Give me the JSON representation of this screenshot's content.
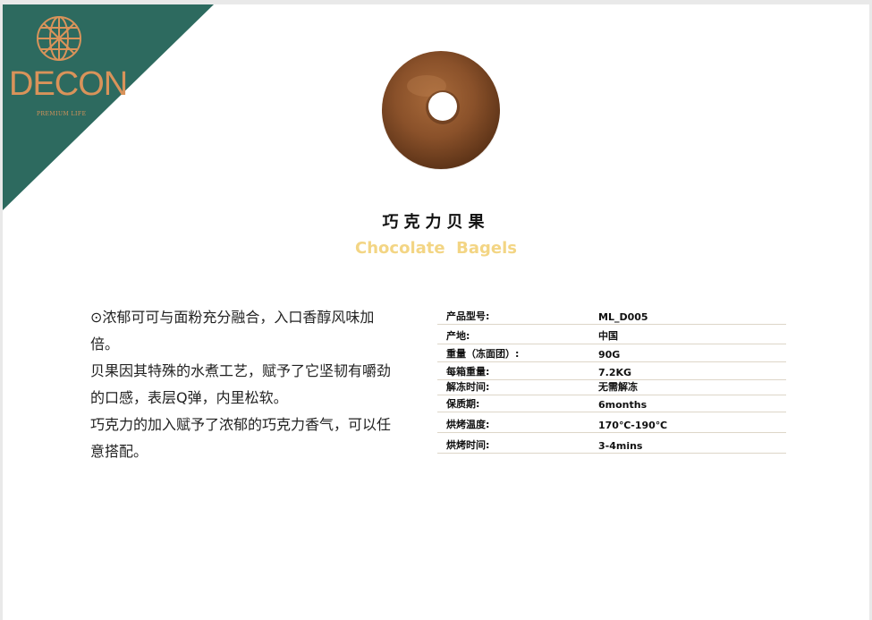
{
  "brand": {
    "name": "DECON",
    "tagline": "PREMIUM LIFE",
    "colors": {
      "banner": "#2d6a5f",
      "gold": "#d9935a"
    }
  },
  "product": {
    "image": "bagel-photo",
    "name_cn": "巧克力贝果",
    "name_en": "Chocolate  Bagels",
    "accent": "#f3d584"
  },
  "description": [
    "⊙浓郁可可与面粉充分融合，入口香醇风味加倍。",
    "贝果因其特殊的水煮工艺，赋予了它坚韧有嚼劲的口感，表层Q弹，内里松软。",
    "巧克力的加入赋予了浓郁的巧克力香气，可以任意搭配。"
  ],
  "specs": [
    {
      "label": "产品型号:",
      "value": "ML_D005"
    },
    {
      "label": "产地:",
      "value": "中国"
    },
    {
      "label": "重量（冻面团）:",
      "value": "90G"
    },
    {
      "label": "每箱重量:",
      "value": "7.2KG"
    },
    {
      "label": "解冻时间:",
      "value": "无需解冻"
    },
    {
      "label": "保质期:",
      "value": "6months"
    },
    {
      "label": "烘烤温度:",
      "value": "170℃-190℃"
    },
    {
      "label": "烘烤时间:",
      "value": "3-4mins"
    }
  ]
}
